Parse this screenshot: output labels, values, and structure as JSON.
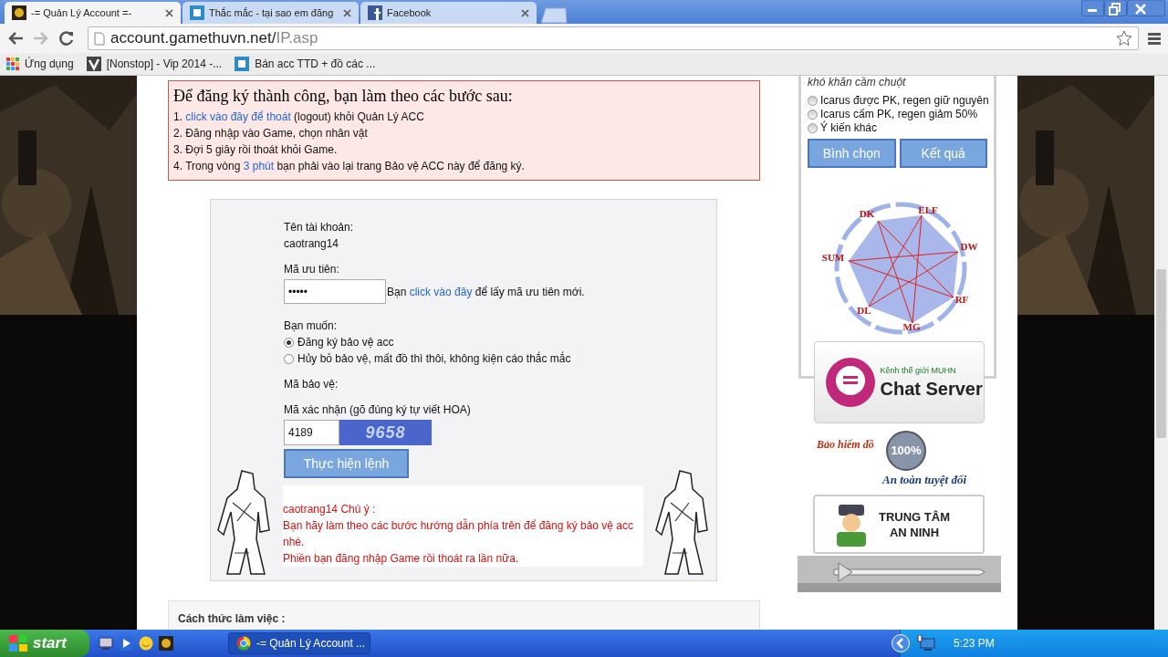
{
  "browser": {
    "tabs": [
      {
        "title": "-= Quản Lý Account =-",
        "selected": true
      },
      {
        "title": "Thắc mắc - tại sao em đăng",
        "selected": false
      },
      {
        "title": "Facebook",
        "selected": false
      }
    ],
    "url": {
      "host": "account.gamethuvn.net/",
      "path": "IP.asp"
    },
    "bookmarks": [
      {
        "label": "Ứng dụng",
        "kind": "apps"
      },
      {
        "label": "[Nonstop] - Vip 2014 -...",
        "kind": "check"
      },
      {
        "label": "Bán acc TTD + đồ các ...",
        "kind": "g"
      }
    ]
  },
  "instructions": {
    "heading": "Để đăng ký thành công, bạn làm theo các bước sau:",
    "steps": [
      [
        {
          "kind": "text",
          "text": "1. "
        },
        {
          "kind": "link",
          "text": "click vào đây để thoát"
        },
        {
          "kind": "text",
          "text": " (logout) khỏi Quản Lý ACC"
        }
      ],
      [
        {
          "kind": "text",
          "text": "2. Đăng nhập vào Game, chọn nhân vật"
        }
      ],
      [
        {
          "kind": "text",
          "text": "3. Đợi 5 giây rồi thoát khỏi Game."
        }
      ],
      [
        {
          "kind": "text",
          "text": "4. Trong vòng "
        },
        {
          "kind": "link",
          "text": "3 phút"
        },
        {
          "kind": "text",
          "text": " bạn phải vào lại trang Bảo vệ ACC này để đăng ký."
        }
      ]
    ]
  },
  "form": {
    "account_label": "Tên tài khoản:",
    "account_value": "caotrang14",
    "priority_label": "Mã ưu tiên:",
    "priority_value": "•••••",
    "priority_hint": [
      {
        "kind": "text",
        "text": "Bạn "
      },
      {
        "kind": "link",
        "text": "click vào đây"
      },
      {
        "kind": "text",
        "text": " để lấy mã ưu tiên mới."
      }
    ],
    "want_label": "Bạn muốn:",
    "options": [
      {
        "label": "Đăng ký bảo vệ acc",
        "selected": true
      },
      {
        "label": "Hủy bỏ bảo vệ, mất đồ thì thôi, không kiện cáo thắc mắc",
        "selected": false
      }
    ],
    "protect_label": "Mã bảo vệ:",
    "captcha_label": "Mã xác nhận (gõ đúng ký tự viết HOA)",
    "captcha_value": "4189",
    "captcha_image": "9658",
    "submit": "Thực hiện lệnh",
    "notice": [
      "caotrang14 Chú ý :",
      "Bạn hãy làm theo các bước hướng dẫn phía trên để đăng ký bảo vệ acc nhé.",
      "Phiền bạn đăng nhập Game rồi thoát ra lần nữa."
    ]
  },
  "footer": {
    "heading": "Cách thức làm việc :"
  },
  "poll": {
    "question": "khó khăn cầm chuột",
    "options": [
      {
        "label": "Icarus được PK, regen giữ nguyên",
        "selected": false
      },
      {
        "label": "Icarus cấm PK, regen giảm 50%",
        "selected": false
      },
      {
        "label": "Ý kiến khác",
        "selected": false
      }
    ],
    "buttons": [
      "Bình chọn",
      "Kết quả"
    ]
  },
  "class_diagram": {
    "labels": [
      "DK",
      "ELF",
      "DW",
      "RF",
      "MG",
      "DL",
      "SUM"
    ]
  },
  "chat_banner": {
    "caption": "Kênh thế giới MUHN",
    "title": "Chat Server"
  },
  "insurance_banner": {
    "top": "Bảo hiểm đồ",
    "badge": "100%",
    "bottom": "An toàn tuyệt đối"
  },
  "security_banner": {
    "lines": [
      "TRUNG TÂM",
      "AN NINH"
    ]
  },
  "taskbar": {
    "start": "start",
    "task": "-= Quản Lý Account ...",
    "clock": "5:23 PM"
  }
}
